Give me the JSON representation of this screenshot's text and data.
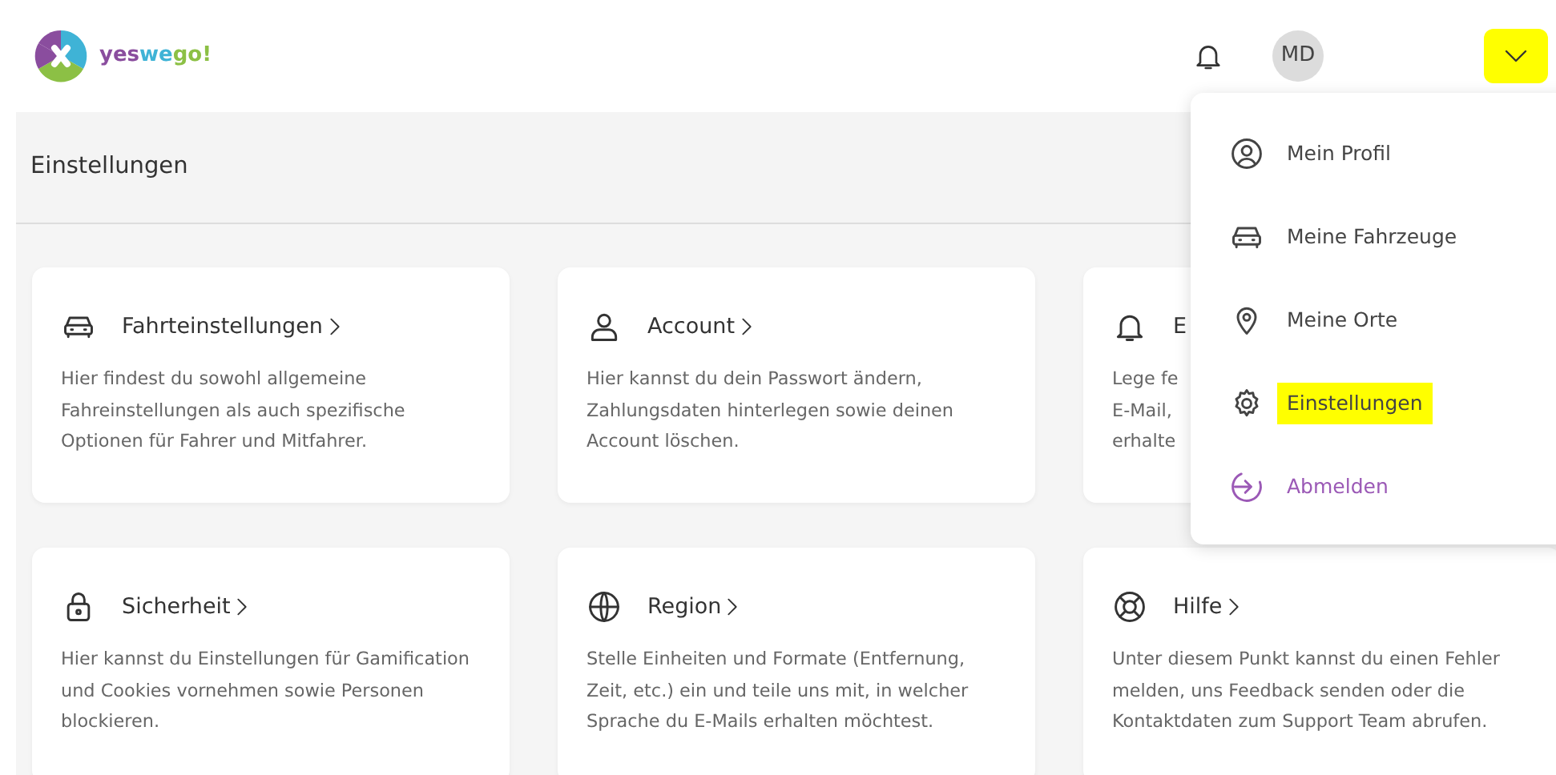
{
  "header": {
    "logo": {
      "parts": [
        {
          "text": "yes",
          "color": "#8a4d9e"
        },
        {
          "text": "we",
          "color": "#3fb3d6"
        },
        {
          "text": "go!",
          "color": "#8cc045"
        }
      ]
    },
    "avatar": {
      "initials": "MD"
    },
    "menu_toggle": {
      "highlighted": true
    }
  },
  "page_title": "Einstellungen",
  "cards": [
    {
      "title": "Fahrteinstellungen",
      "description": "Hier findest du sowohl allgemeine Fahreinstellungen als auch spezifische Optionen für Fahrer und Mitfahrer."
    },
    {
      "title": "Account",
      "description": "Hier kannst du dein Passwort ändern, Zahlungsdaten hinterlegen sowie deinen Account löschen."
    },
    {
      "title": "E",
      "description": "Lege fe\nE-Mail,\nerhalte"
    },
    {
      "title": "Sicherheit",
      "description": "Hier kannst du Einstellungen für Gamification und Cookies vornehmen sowie Personen blockieren."
    },
    {
      "title": "Region",
      "description": "Stelle Einheiten und Formate (Entfernung, Zeit, etc.) ein und teile uns mit, in welcher Sprache du E-Mails erhalten möchtest."
    },
    {
      "title": "Hilfe",
      "description": "Unter diesem Punkt kannst du einen Fehler melden, uns Feedback senden oder die Kontaktdaten zum Support Team abrufen."
    }
  ],
  "user_menu": [
    {
      "label": "Mein Profil",
      "highlighted": false,
      "kind": "normal"
    },
    {
      "label": "Meine Fahrzeuge",
      "highlighted": false,
      "kind": "normal"
    },
    {
      "label": "Meine Orte",
      "highlighted": false,
      "kind": "normal"
    },
    {
      "label": "Einstellungen",
      "highlighted": true,
      "kind": "normal"
    },
    {
      "label": "Abmelden",
      "highlighted": false,
      "kind": "logout"
    }
  ]
}
